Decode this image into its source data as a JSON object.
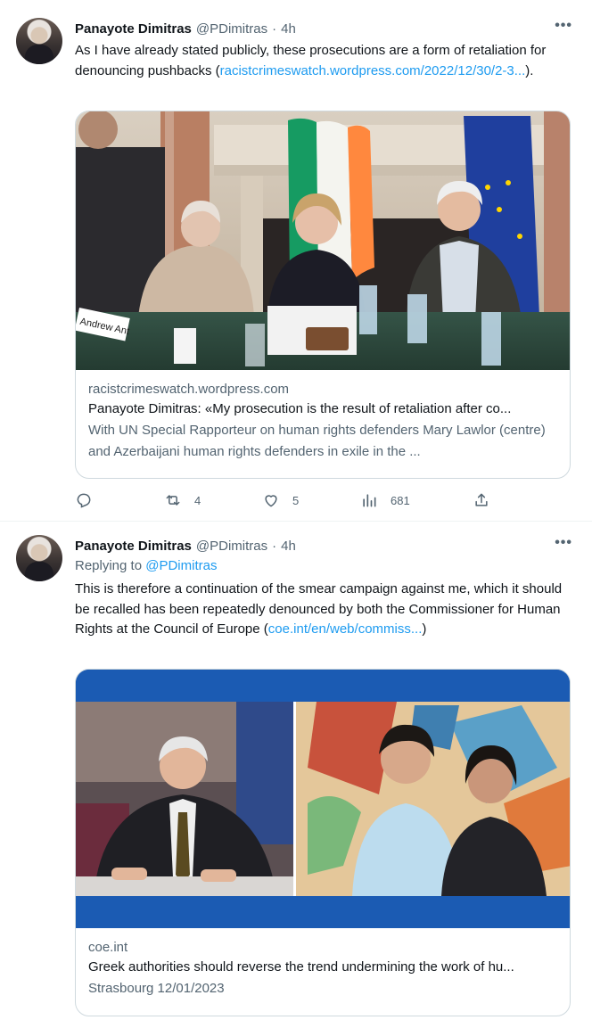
{
  "tweets": [
    {
      "author": {
        "name": "Panayote Dimitras",
        "handle": "@PDimitras",
        "time": "4h"
      },
      "text_before": "As I have already stated publicly, these prosecutions are a form of retaliation for denouncing pushbacks (",
      "link_text": "racistcrimeswatch.wordpress.com/2022/12/30/2-3...",
      "text_after": ").",
      "card": {
        "domain": "racistcrimeswatch.wordpress.com",
        "title": "Panayote Dimitras: «My prosecution is the result of retaliation after co...",
        "description": "With UN Special Rapporteur on human rights defenders Mary Lawlor (centre) and Azerbaijani human rights defenders in exile in the ...",
        "image_label": "Andrew Ant"
      },
      "stats": {
        "replies": "",
        "retweets": "4",
        "likes": "5",
        "views": "681"
      }
    },
    {
      "author": {
        "name": "Panayote Dimitras",
        "handle": "@PDimitras",
        "time": "4h"
      },
      "reply_prefix": "Replying to",
      "reply_handle": "@PDimitras",
      "text_before": "This is therefore a continuation of the smear campaign against me, which it should be recalled has been repeatedly denounced by both the Commissioner for Human Rights at the Council of Europe (",
      "link_text": "coe.int/en/web/commiss...",
      "text_after": ")",
      "card": {
        "domain": "coe.int",
        "title": "Greek authorities should reverse the trend undermining the work of hu...",
        "description": "Strasbourg 12/01/2023"
      }
    }
  ],
  "colors": {
    "accent": "#1d9bf0",
    "secondary": "#536471",
    "border": "#cfd9de",
    "coe_blue": "#1b5bb3"
  },
  "icons": [
    "more-icon",
    "reply-icon",
    "retweet-icon",
    "like-icon",
    "views-icon",
    "share-icon"
  ]
}
